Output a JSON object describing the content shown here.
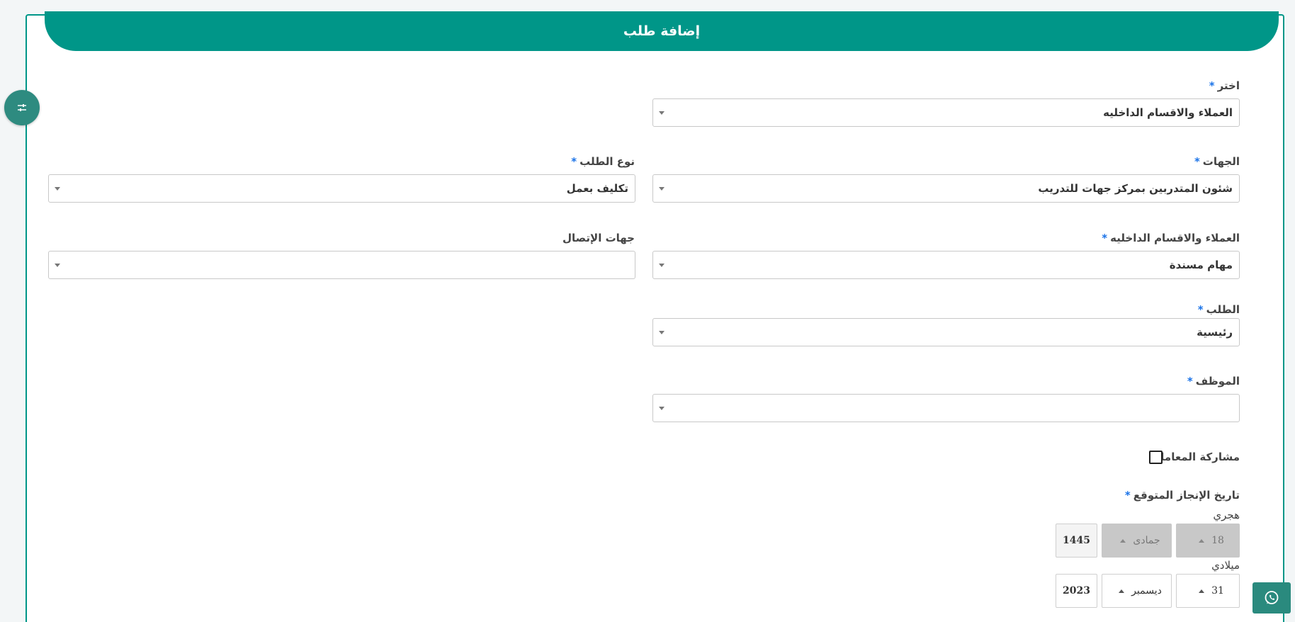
{
  "header": {
    "title": "إضافة طلب"
  },
  "form": {
    "choose": {
      "label": "اختر",
      "required": "*",
      "value": "العملاء والاقسام الداخليه"
    },
    "entities": {
      "label": "الجهات",
      "required": "*",
      "value": "شئون المتدربين بمركز جهات للتدريب"
    },
    "request_type": {
      "label": "نوع الطلب",
      "required": "*",
      "value": "تكليف بعمل"
    },
    "clients_departments": {
      "label": "العملاء والاقسام الداخليه",
      "required": "*",
      "value": "مهام مسندة"
    },
    "contacts": {
      "label": "جهات الإتصال",
      "value": ""
    },
    "request": {
      "label": "الطلب",
      "required": "*",
      "value": "رئيسية"
    },
    "employee": {
      "label": "الموظف",
      "required": "*",
      "value": ""
    },
    "share_transaction": {
      "label": "مشاركة المعاملة",
      "checked": false
    },
    "expected_completion": {
      "label": "تاريخ الإنجاز المتوقع",
      "required": "*",
      "hijri": {
        "label": "هجري",
        "day": "18",
        "month": "جمادى",
        "year": "1445"
      },
      "gregorian": {
        "label": "ميلادي",
        "day": "31",
        "month": "ديسمبر",
        "year": "2023"
      }
    }
  },
  "icons": {
    "side_toggle": "sliders-icon",
    "chat": "whatsapp-icon"
  },
  "colors": {
    "brand": "#009688",
    "required_marker": "#1a73e8"
  }
}
